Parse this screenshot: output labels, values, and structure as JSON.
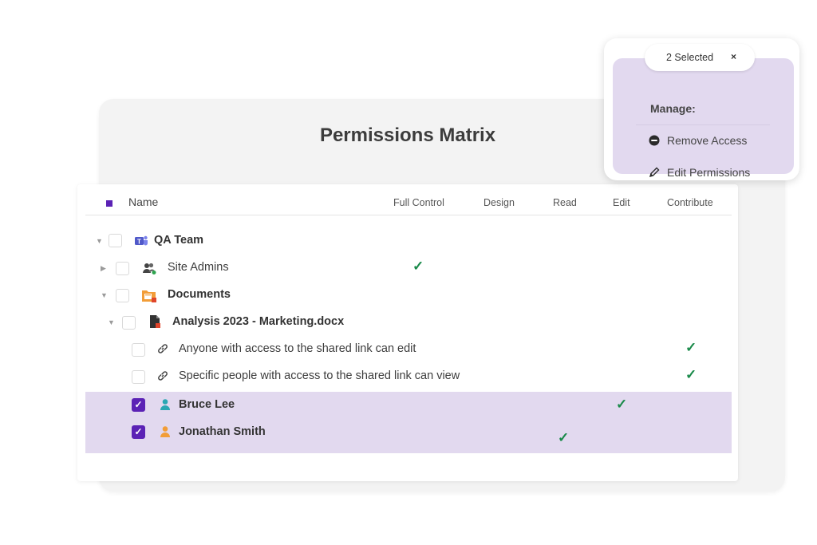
{
  "page": {
    "title": "Permissions Matrix"
  },
  "table": {
    "name_header": "Name",
    "columns": [
      "Full Control",
      "Design",
      "Read",
      "Edit",
      "Contribute"
    ],
    "rows": [
      {
        "label": "QA Team",
        "icon": "teams-icon",
        "bold": true,
        "expanded": true,
        "checked": false,
        "permission": null
      },
      {
        "label": "Site Admins",
        "icon": "group-icon",
        "bold": false,
        "expanded": false,
        "checked": false,
        "permission": "Full Control"
      },
      {
        "label": "Documents",
        "icon": "library-icon",
        "bold": true,
        "expanded": true,
        "checked": false,
        "permission": null
      },
      {
        "label": "Analysis 2023 - Marketing.docx",
        "icon": "document-icon",
        "bold": true,
        "expanded": true,
        "checked": false,
        "permission": null
      },
      {
        "label": "Anyone with access to the shared link can edit",
        "icon": "link-icon",
        "bold": false,
        "checked": false,
        "permission": "Contribute"
      },
      {
        "label": "Specific people with access to the shared link can view",
        "icon": "link-icon",
        "bold": false,
        "checked": false,
        "permission": "Contribute"
      },
      {
        "label": "Bruce Lee",
        "icon": "user-icon",
        "bold": true,
        "checked": true,
        "permission": "Edit"
      },
      {
        "label": "Jonathan Smith",
        "icon": "user-icon",
        "bold": true,
        "checked": true,
        "permission": "Read"
      }
    ]
  },
  "popup": {
    "selected_label": "2 Selected",
    "close_glyph": "×",
    "manage_label": "Manage:",
    "actions": [
      {
        "label": "Remove Access",
        "icon": "minus-circle-icon"
      },
      {
        "label": "Edit Permissions",
        "icon": "pencil-icon"
      }
    ]
  },
  "colors": {
    "accent": "#5b22b5",
    "selection": "#e2d9ef",
    "check": "#1a8a4a"
  }
}
